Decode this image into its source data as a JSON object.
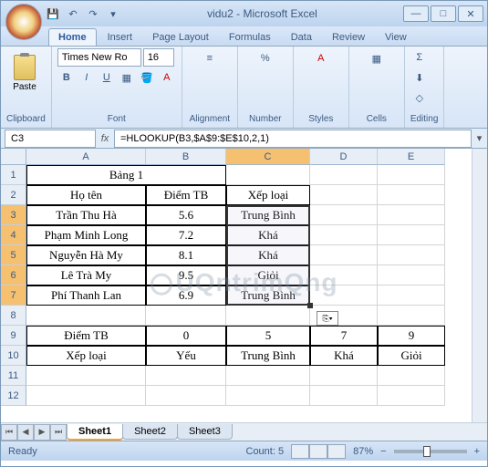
{
  "window": {
    "title": "vidu2 - Microsoft Excel",
    "min": "—",
    "max": "□",
    "close": "✕"
  },
  "tabs": {
    "home": "Home",
    "insert": "Insert",
    "page_layout": "Page Layout",
    "formulas": "Formulas",
    "data": "Data",
    "review": "Review",
    "view": "View"
  },
  "ribbon": {
    "clipboard": {
      "paste": "Paste",
      "title": "Clipboard"
    },
    "font": {
      "name": "Times New Ro",
      "size": "16",
      "bold": "B",
      "italic": "I",
      "underline": "U",
      "title": "Font"
    },
    "alignment": {
      "title": "Alignment"
    },
    "number": {
      "pct": "%",
      "title": "Number"
    },
    "styles": {
      "title": "Styles"
    },
    "cells": {
      "title": "Cells"
    },
    "editing": {
      "sigma": "Σ",
      "title": "Editing"
    }
  },
  "namebox": "C3",
  "formula": "=HLOOKUP(B3,$A$9:$E$10,2,1)",
  "cols": [
    "A",
    "B",
    "C",
    "D",
    "E"
  ],
  "rows": [
    "1",
    "2",
    "3",
    "4",
    "5",
    "6",
    "7",
    "8",
    "9",
    "10",
    "11",
    "12"
  ],
  "cells": {
    "a1": "Bảng 1",
    "a2": "Họ tên",
    "b2": "Điểm TB",
    "c2": "Xếp loại",
    "a3": "Trần Thu Hà",
    "b3": "5.6",
    "c3": "Trung Bình",
    "a4": "Phạm Minh Long",
    "b4": "7.2",
    "c4": "Khá",
    "a5": "Nguyễn Hà My",
    "b5": "8.1",
    "c5": "Khá",
    "a6": "Lê Trà My",
    "b6": "9.5",
    "c6": "Giỏi",
    "a7": "Phí Thanh Lan",
    "b7": "6.9",
    "c7": "Trung Bình",
    "a9": "Điểm TB",
    "b9": "0",
    "c9": "5",
    "d9": "7",
    "e9": "9",
    "a10": "Xếp loại",
    "b10": "Yếu",
    "c10": "Trung Bình",
    "d10": "Khá",
    "e10": "Giỏi"
  },
  "sheets": {
    "s1": "Sheet1",
    "s2": "Sheet2",
    "s3": "Sheet3"
  },
  "status": {
    "ready": "Ready",
    "count": "Count: 5",
    "zoom": "87%"
  },
  "autofill_btn": "⎘▾",
  "watermark": "UQntrimQng"
}
